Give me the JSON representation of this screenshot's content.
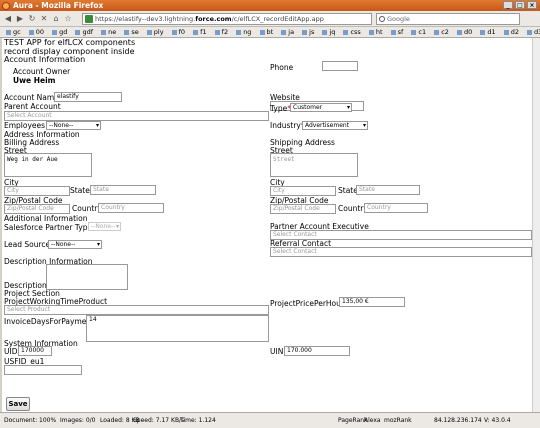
{
  "window": {
    "title": "Aura - Mozilla Firefox"
  },
  "browser": {
    "url_prefix": "https://elastify--dev3.lightning.",
    "url_domain": "force.com",
    "url_suffix": "/c/elfLCX_recordEditApp.app",
    "search_placeholder": "Google",
    "bookmarks": [
      "gc",
      "00",
      "gd",
      "gdf",
      "ne",
      "se",
      "ply",
      "f0",
      "f1",
      "f2",
      "ng",
      "bt",
      "ja",
      "js",
      "jq",
      "css",
      "ht",
      "sf",
      "c1",
      "c2",
      "d0",
      "d1",
      "d2",
      "d3"
    ]
  },
  "page": {
    "app_title": "TEST APP for elfLCX components",
    "subtitle": "record display component inside",
    "account_info_heading": "Account Information",
    "account_owner_label": "Account Owner",
    "account_owner_value": "Uwe Heim",
    "phone_label": "Phone",
    "account_name_label": "Account Name",
    "account_name_value": "elastify",
    "website_label": "Website",
    "parent_account_label": "Parent Account",
    "parent_account_placeholder": "Select Account",
    "type_label": "Type",
    "type_value": "Customer",
    "employees_label": "Employees",
    "employees_value": "--None--",
    "industry_label": "Industry",
    "industry_value": "Advertisement",
    "address_heading": "Address Information",
    "billing_address_label": "Billing Address",
    "shipping_address_label": "Shipping Address",
    "street_label": "Street",
    "billing_street_value": "Weg in der Aue",
    "shipping_street_placeholder": "Street",
    "city_label": "City",
    "city_placeholder": "City",
    "state_label": "State",
    "state_placeholder": "State",
    "zip_label": "Zip/Postal Code",
    "zip_placeholder": "Zip/Postal Code",
    "country_label": "Country",
    "country_placeholder": "Country",
    "additional_heading": "Additional Information",
    "sf_partner_type_label": "Salesforce Partner Type",
    "sf_partner_type_value": "--None--",
    "partner_exec_label": "Partner Account Executive",
    "select_contact_placeholder": "Select Contact",
    "referral_contact_label": "Referral Contact",
    "lead_source_label": "Lead Source",
    "lead_source_value": "--None--",
    "description_heading": "Description Information",
    "description_label": "Description",
    "project_heading": "Project Section",
    "project_working_time_label": "ProjectWorkingTimeProduct",
    "select_product_placeholder": "Select Product",
    "project_price_label": "ProjectPricePerHour",
    "project_price_value": "135,00 €",
    "invoice_days_label": "InvoiceDaysForPayment",
    "invoice_days_value": "14",
    "system_heading": "System Information",
    "uid_label": "UID",
    "uid_value": "170000",
    "uin_label": "UIN",
    "uin_value": "170.000",
    "usfid_label": "USFID_eu1",
    "save_label": "Save",
    "required_marker": "*"
  },
  "status": {
    "document": "Document: 100%",
    "images": "Images: 0/0",
    "loaded": "Loaded: 8 KB",
    "speed": "Speed: 7.17 KB/s",
    "time": "Time: 1.124",
    "pagerank": "PageRank",
    "alexa": "Alexa",
    "mozrank": "mozRank",
    "ip": "84.128.236.174",
    "version": "V: 43.0.4"
  }
}
